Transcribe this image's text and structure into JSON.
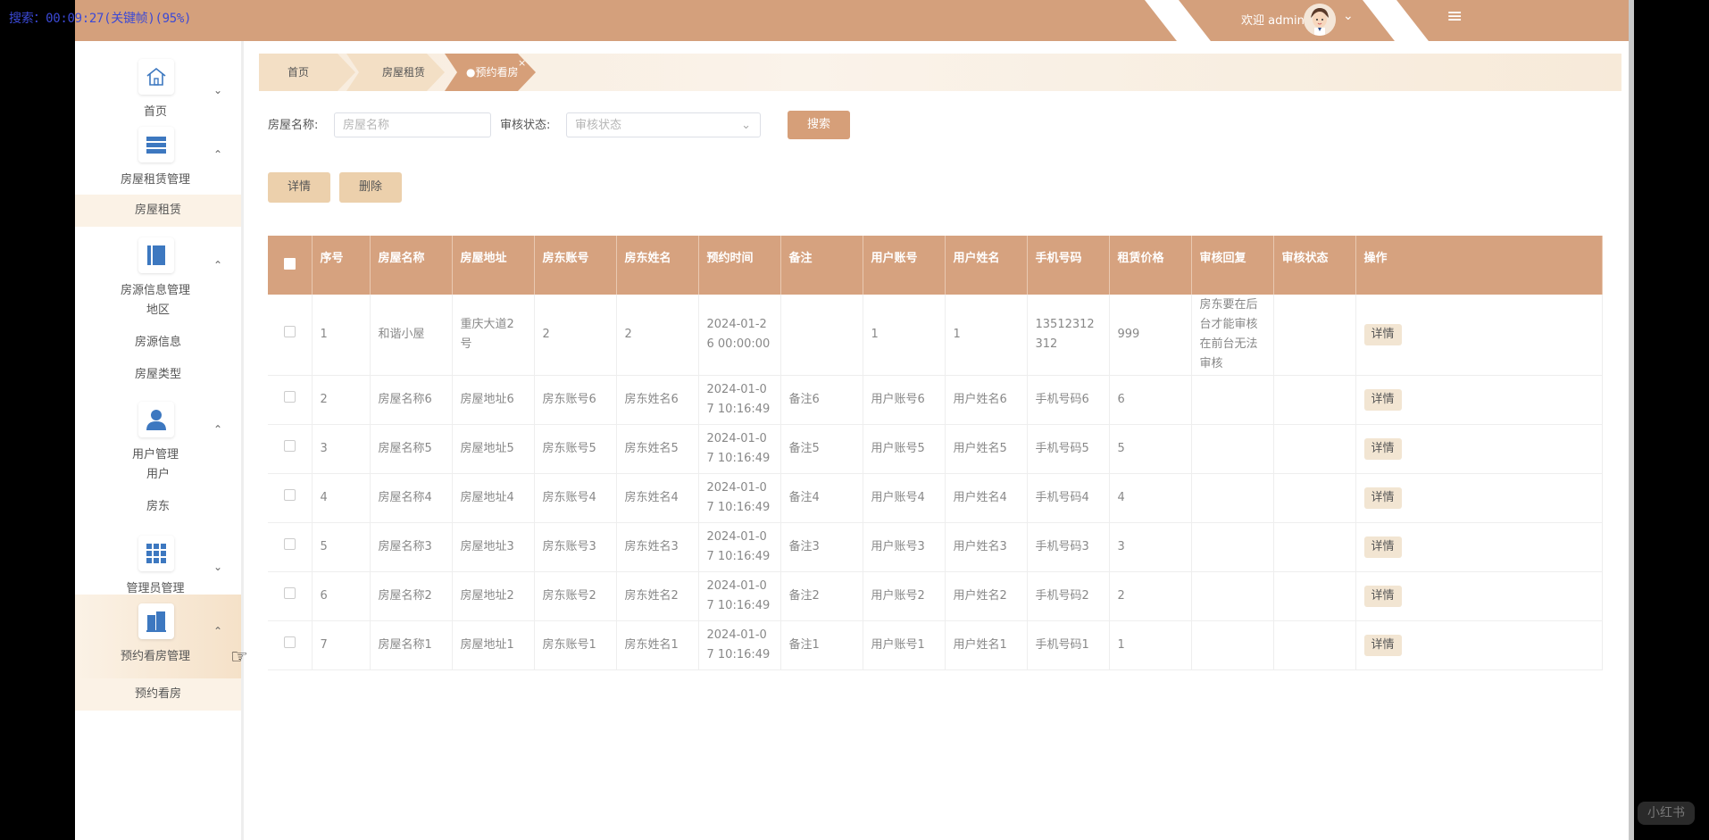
{
  "overlay": {
    "text": "搜索：00:09:27(关键帧)(95%)"
  },
  "header": {
    "welcome": "欢迎 admin",
    "dropdown_icon": "chevron-down-icon",
    "menu_icon": "hamburger-icon"
  },
  "sidebar": {
    "groups": [
      {
        "label": "首页",
        "icon": "home-icon",
        "expanded": false
      },
      {
        "label": "房屋租赁管理",
        "icon": "stack-icon",
        "expanded": true,
        "items": [
          "房屋租赁"
        ]
      },
      {
        "label": "房源信息管理",
        "icon": "book-icon",
        "expanded": true,
        "items": [
          "地区",
          "房源信息",
          "房屋类型"
        ]
      },
      {
        "label": "用户管理",
        "icon": "user-icon",
        "expanded": true,
        "items": [
          "用户",
          "房东"
        ]
      },
      {
        "label": "管理员管理",
        "icon": "grid-icon",
        "expanded": false
      },
      {
        "label": "预约看房管理",
        "icon": "building-icon",
        "expanded": true,
        "items": [
          "预约看房"
        ]
      }
    ]
  },
  "breadcrumb": {
    "items": [
      "首页",
      "房屋租赁",
      "●预约看房"
    ],
    "close": "×"
  },
  "filters": {
    "name_label": "房屋名称:",
    "name_placeholder": "房屋名称",
    "status_label": "审核状态:",
    "status_placeholder": "审核状态",
    "search_button": "搜索"
  },
  "actions": {
    "detail": "详情",
    "delete": "删除"
  },
  "table": {
    "headers": [
      "序号",
      "房屋名称",
      "房屋地址",
      "房东账号",
      "房东姓名",
      "预约时间",
      "备注",
      "用户账号",
      "用户姓名",
      "手机号码",
      "租赁价格",
      "审核回复",
      "审核状态",
      "操作"
    ],
    "rows": [
      {
        "cells": [
          "1",
          "和谐小屋",
          "重庆大道2号",
          "2",
          "2",
          "2024-01-26 00:00:00",
          "",
          "1",
          "1",
          "13512312312",
          "999",
          "房东要在后台才能审核在前台无法审核",
          ""
        ],
        "action": "详情"
      },
      {
        "cells": [
          "2",
          "房屋名称6",
          "房屋地址6",
          "房东账号6",
          "房东姓名6",
          "2024-01-07 10:16:49",
          "备注6",
          "用户账号6",
          "用户姓名6",
          "手机号码6",
          "6",
          "",
          ""
        ],
        "action": "详情"
      },
      {
        "cells": [
          "3",
          "房屋名称5",
          "房屋地址5",
          "房东账号5",
          "房东姓名5",
          "2024-01-07 10:16:49",
          "备注5",
          "用户账号5",
          "用户姓名5",
          "手机号码5",
          "5",
          "",
          ""
        ],
        "action": "详情"
      },
      {
        "cells": [
          "4",
          "房屋名称4",
          "房屋地址4",
          "房东账号4",
          "房东姓名4",
          "2024-01-07 10:16:49",
          "备注4",
          "用户账号4",
          "用户姓名4",
          "手机号码4",
          "4",
          "",
          ""
        ],
        "action": "详情"
      },
      {
        "cells": [
          "5",
          "房屋名称3",
          "房屋地址3",
          "房东账号3",
          "房东姓名3",
          "2024-01-07 10:16:49",
          "备注3",
          "用户账号3",
          "用户姓名3",
          "手机号码3",
          "3",
          "",
          ""
        ],
        "action": "详情"
      },
      {
        "cells": [
          "6",
          "房屋名称2",
          "房屋地址2",
          "房东账号2",
          "房东姓名2",
          "2024-01-07 10:16:49",
          "备注2",
          "用户账号2",
          "用户姓名2",
          "手机号码2",
          "2",
          "",
          ""
        ],
        "action": "详情"
      },
      {
        "cells": [
          "7",
          "房屋名称1",
          "房屋地址1",
          "房东账号1",
          "房东姓名1",
          "2024-01-07 10:16:49",
          "备注1",
          "用户账号1",
          "用户姓名1",
          "手机号码1",
          "1",
          "",
          ""
        ],
        "action": "详情"
      }
    ]
  },
  "watermark": "小红书",
  "colors": {
    "accent": "#d4a07c",
    "icon_blue": "#3d78c0",
    "button_pale": "#ecd0ac"
  }
}
